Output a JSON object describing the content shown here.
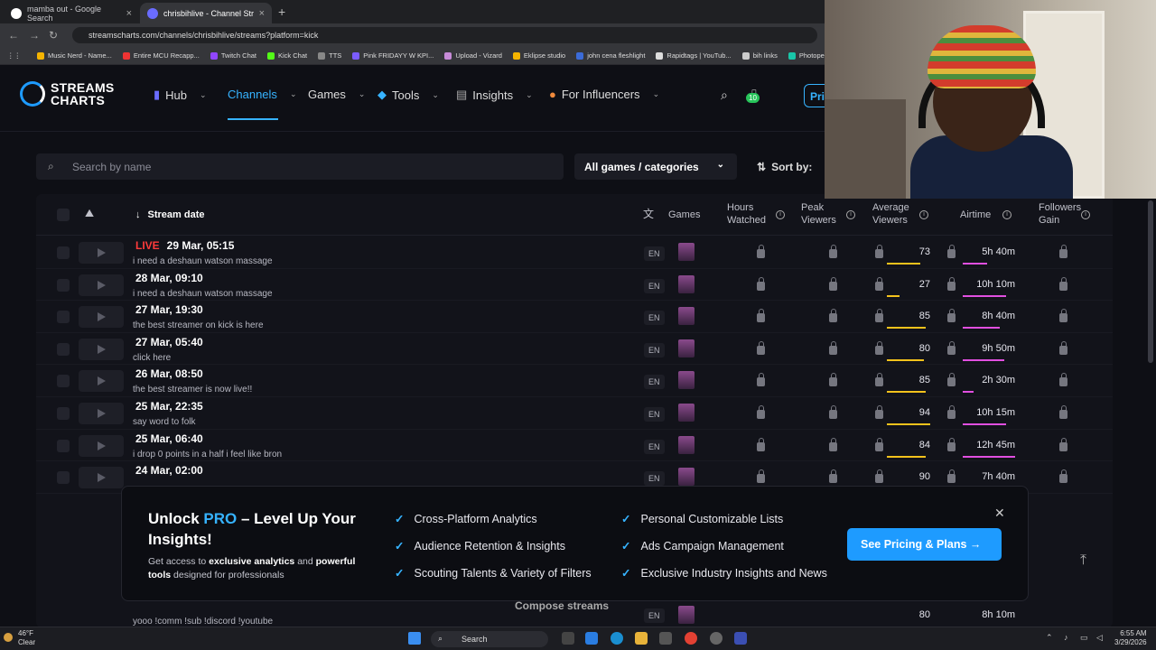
{
  "browser": {
    "tabs": [
      {
        "label": "mamba out - Google Search",
        "active": false
      },
      {
        "label": "chrisbihlive - Channel Streams ·",
        "active": true
      }
    ],
    "url": "streamscharts.com/channels/chrisbihlive/streams?platform=kick",
    "bookmarks": [
      "Music Nerd - Name...",
      "Entire MCU Recapp...",
      "Twitch Chat",
      "Kick Chat",
      "TTS",
      "Pink FRIDAYY W KPI...",
      "Upload - Vizard",
      "Eklipse studio",
      "john cena fleshlight",
      "Rapidtags | YouTub...",
      "bih links",
      "Photopea"
    ]
  },
  "site": {
    "logo_line1": "STREAMS",
    "logo_line2": "CHARTS",
    "nav": [
      "Hub",
      "Channels",
      "Games",
      "Tools",
      "Insights",
      "For Influencers"
    ],
    "badge_count": "10",
    "pricing_short": "Pri"
  },
  "filters": {
    "search_placeholder": "Search by name",
    "games_filter": "All games / categories",
    "sort_by": "Sort by:"
  },
  "table": {
    "headers": {
      "stream_date": "Stream date",
      "games": "Games",
      "hours_watched": "Hours Watched",
      "peak_viewers": "Peak Viewers",
      "average_viewers": "Average Viewers",
      "airtime": "Airtime",
      "followers_gain": "Followers Gain"
    },
    "live_label": "LIVE",
    "rows": [
      {
        "date": "29 Mar, 05:15",
        "title": "i need a deshaun watson massage",
        "lang": "EN",
        "avg": "73",
        "airtime": "5h 40m",
        "avg_frac": 0.78,
        "air_frac": 0.46,
        "live": true
      },
      {
        "date": "28 Mar, 09:10",
        "title": "i need a deshaun watson massage",
        "lang": "EN",
        "avg": "27",
        "airtime": "10h 10m",
        "avg_frac": 0.29,
        "air_frac": 0.82,
        "live": false
      },
      {
        "date": "27 Mar, 19:30",
        "title": "the best streamer on kick is here",
        "lang": "EN",
        "avg": "85",
        "airtime": "8h 40m",
        "avg_frac": 0.9,
        "air_frac": 0.7,
        "live": false
      },
      {
        "date": "27 Mar, 05:40",
        "title": "click here",
        "lang": "EN",
        "avg": "80",
        "airtime": "9h 50m",
        "avg_frac": 0.85,
        "air_frac": 0.79,
        "live": false
      },
      {
        "date": "26 Mar, 08:50",
        "title": "the best streamer is now live!!",
        "lang": "EN",
        "avg": "85",
        "airtime": "2h 30m",
        "avg_frac": 0.9,
        "air_frac": 0.2,
        "live": false
      },
      {
        "date": "25 Mar, 22:35",
        "title": "say word to folk",
        "lang": "EN",
        "avg": "94",
        "airtime": "10h 15m",
        "avg_frac": 1.0,
        "air_frac": 0.83,
        "live": false
      },
      {
        "date": "25 Mar, 06:40",
        "title": "i drop 0 points in a half i feel like bron",
        "lang": "EN",
        "avg": "84",
        "airtime": "12h 45m",
        "avg_frac": 0.89,
        "air_frac": 1.0,
        "live": false
      },
      {
        "date": "24 Mar, 02:00",
        "title": "",
        "lang": "EN",
        "avg": "90",
        "airtime": "7h 40m",
        "avg_frac": 0.96,
        "air_frac": 0.62,
        "live": false
      }
    ],
    "bottom_row": {
      "title": "yooo !comm !sub !discord !youtube",
      "lang": "EN",
      "avg": "80",
      "airtime": "8h 10m"
    }
  },
  "promo": {
    "heading_prefix": "Unlock ",
    "heading_pro": "PRO",
    "heading_suffix": " – Level Up Your Insights!",
    "desc_a": "Get access to ",
    "desc_b": "exclusive analytics",
    "desc_c": " and ",
    "desc_d": "powerful tools",
    "desc_e": " designed for professionals",
    "features": [
      "Cross-Platform Analytics",
      "Audience Retention & Insights",
      "Scouting Talents & Variety of Filters",
      "Personal Customizable Lists",
      "Ads Campaign Management",
      "Exclusive Industry Insights and News"
    ],
    "cta": "See Pricing & Plans →",
    "compose": "Compose streams"
  },
  "taskbar": {
    "temp": "46°F",
    "weather": "Clear",
    "search": "Search",
    "time": "6:55 AM",
    "date": "3/29/2026"
  },
  "colors": {
    "accent": "#36b3ff",
    "avg_bar": "#f4c21c",
    "airtime_bar": "#e14fe0",
    "live": "#ff3b3b"
  }
}
